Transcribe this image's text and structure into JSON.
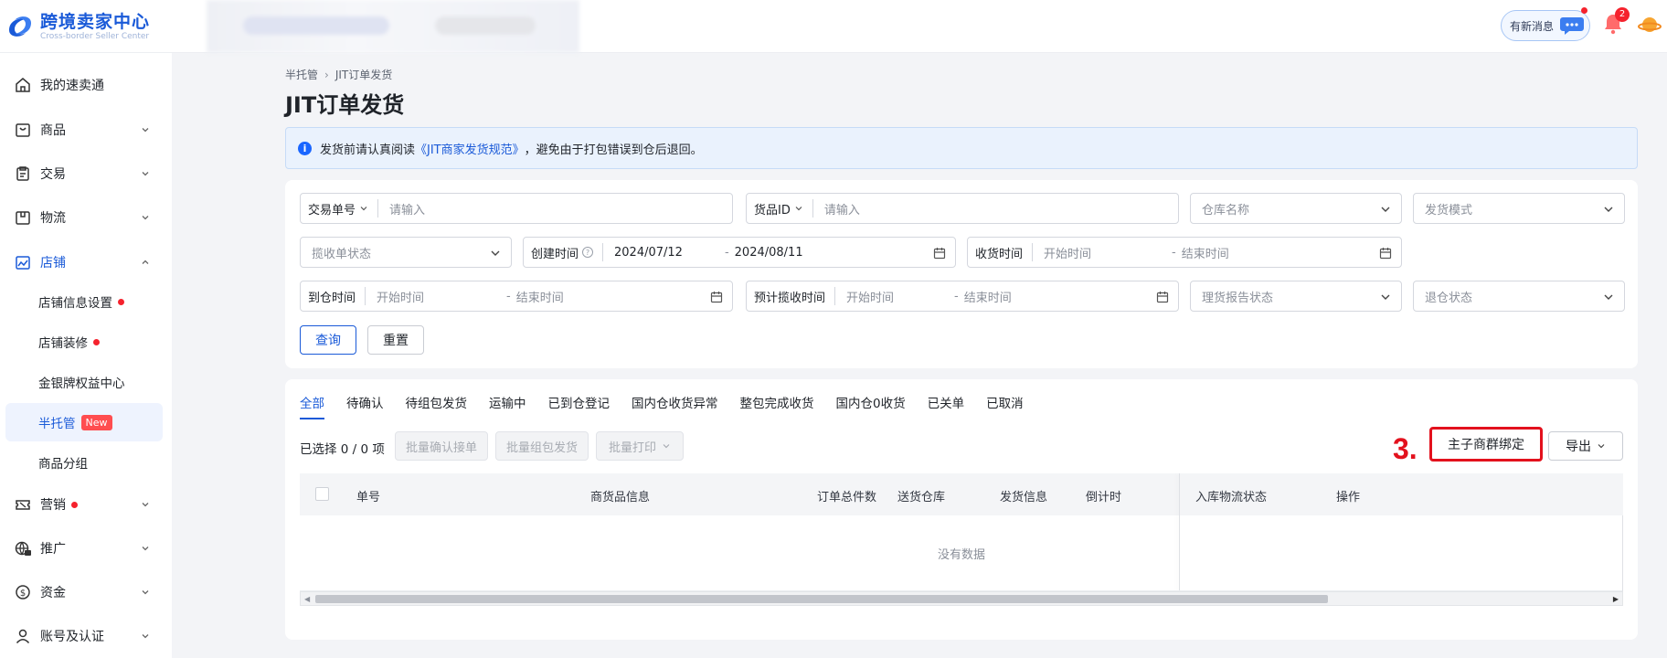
{
  "header": {
    "logo_title": "跨境卖家中心",
    "logo_subtitle": "Cross-border Seller Center",
    "message_button": "有新消息",
    "notification_count": "2",
    "brand_color": "#1a5ad8"
  },
  "sidebar": {
    "items": [
      {
        "label": "我的速卖通",
        "icon": "home-icon"
      },
      {
        "label": "商品",
        "icon": "product-icon"
      },
      {
        "label": "交易",
        "icon": "clipboard-icon"
      },
      {
        "label": "物流",
        "icon": "box-icon"
      },
      {
        "label": "店铺",
        "icon": "store-icon"
      },
      {
        "label": "营销",
        "icon": "ticket-icon"
      },
      {
        "label": "推广",
        "icon": "ad-globe-icon"
      },
      {
        "label": "资金",
        "icon": "dollar-icon"
      },
      {
        "label": "账号及认证",
        "icon": "user-icon"
      }
    ],
    "store_sub": [
      {
        "label": "店铺信息设置"
      },
      {
        "label": "店铺装修"
      },
      {
        "label": "金银牌权益中心"
      },
      {
        "label": "半托管",
        "tag": "New"
      },
      {
        "label": "商品分组"
      }
    ]
  },
  "breadcrumb": {
    "parent": "半托管",
    "current": "JIT订单发货"
  },
  "page_title": "JIT订单发货",
  "notice": {
    "before": "发货前请认真阅读",
    "link": "《JIT商家发货规范》",
    "after": "，避免由于打包错误到仓后退回。"
  },
  "filters": {
    "trade_no_label": "交易单号",
    "trade_no_placeholder": "请输入",
    "goods_id_label": "货品ID",
    "goods_id_placeholder": "请输入",
    "warehouse_placeholder": "仓库名称",
    "ship_mode_placeholder": "发货模式",
    "pickup_status_placeholder": "揽收单状态",
    "created_label": "创建时间",
    "created_start": "2024/07/12",
    "created_end": "2024/08/11",
    "receive_label": "收货时间",
    "start_placeholder": "开始时间",
    "end_placeholder": "结束时间",
    "arrive_label": "到仓时间",
    "est_pickup_label": "预计揽收时间",
    "report_status_placeholder": "理货报告状态",
    "return_status_placeholder": "退仓状态",
    "query_button": "查询",
    "reset_button": "重置"
  },
  "orders": {
    "tabs": [
      "全部",
      "待确认",
      "待组包发货",
      "运输中",
      "已到仓登记",
      "国内仓收货异常",
      "整包完成收货",
      "国内仓0收货",
      "已关单",
      "已取消"
    ],
    "active_tab": 0,
    "selected_text": "已选择 0 / 0 项",
    "batch_confirm": "批量确认接单",
    "batch_pack": "批量组包发货",
    "batch_print": "批量打印",
    "bind_button": "主子商群绑定",
    "export_button": "导出",
    "step_marker": "3.",
    "columns": [
      "单号",
      "商货品信息",
      "订单总件数",
      "送货仓库",
      "发货信息",
      "倒计时",
      "入库物流状态",
      "操作"
    ],
    "empty_text": "没有数据",
    "highlight_color": "#e3111d"
  }
}
